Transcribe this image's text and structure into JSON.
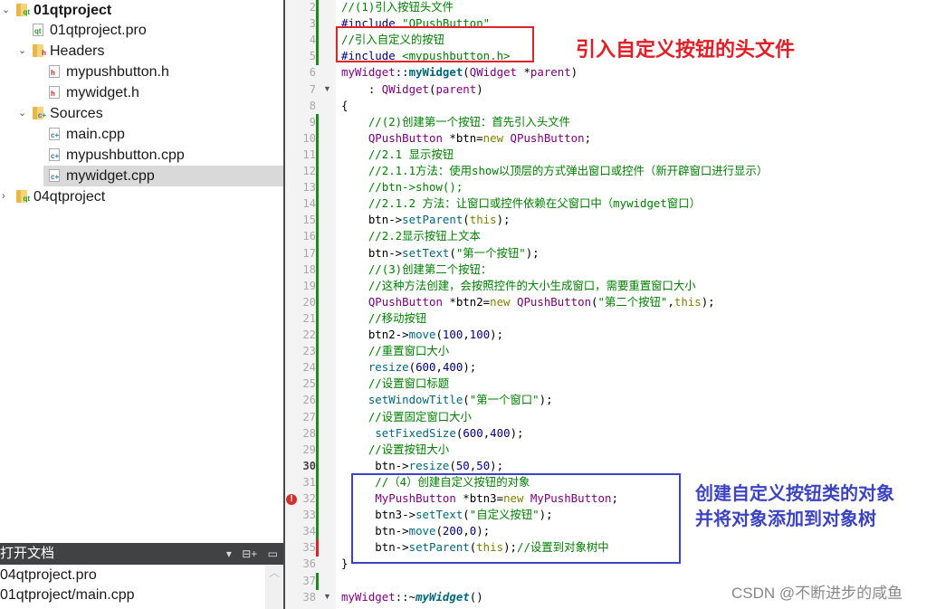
{
  "project_tree": {
    "items": [
      {
        "label": "01qtproject",
        "icon": "qt-project-folder-icon",
        "expanded": true,
        "bold": true
      },
      {
        "label": "01qtproject.pro",
        "icon": "qt-pro-file-icon"
      },
      {
        "label": "Headers",
        "icon": "headers-folder-icon",
        "expanded": true
      },
      {
        "label": "mypushbutton.h",
        "icon": "header-file-icon"
      },
      {
        "label": "mywidget.h",
        "icon": "header-file-icon"
      },
      {
        "label": "Sources",
        "icon": "sources-folder-icon",
        "expanded": true
      },
      {
        "label": "main.cpp",
        "icon": "cpp-file-icon"
      },
      {
        "label": "mypushbutton.cpp",
        "icon": "cpp-file-icon"
      },
      {
        "label": "mywidget.cpp",
        "icon": "cpp-file-icon",
        "selected": true
      },
      {
        "label": "04qtproject",
        "icon": "qt-project-folder-icon",
        "expanded": false
      }
    ]
  },
  "open_documents": {
    "title": "打开文档",
    "items": [
      "04qtproject.pro",
      "01qtproject/main.cpp"
    ]
  },
  "editor": {
    "lines": [
      {
        "n": "2",
        "parts": [
          [
            "cm",
            "//(1)引入按钮头文件"
          ]
        ]
      },
      {
        "n": "3",
        "parts": [
          [
            "pp",
            "#include "
          ],
          [
            "str",
            "\"QPushButton\""
          ]
        ]
      },
      {
        "n": "4",
        "parts": [
          [
            "cm",
            "//引入自定义的按钮"
          ]
        ]
      },
      {
        "n": "5",
        "parts": [
          [
            "pp",
            "#include "
          ],
          [
            "str",
            "<mypushbutton.h>"
          ]
        ]
      },
      {
        "n": "6",
        "parts": [
          [
            "ty",
            "myWidget"
          ],
          [
            "plain",
            "::"
          ],
          [
            "fnb",
            "myWidget"
          ],
          [
            "plain",
            "("
          ],
          [
            "ty",
            "QWidget"
          ],
          [
            "plain",
            " *"
          ],
          [
            "ty",
            "parent"
          ],
          [
            "plain",
            ")"
          ]
        ]
      },
      {
        "n": "7",
        "parts": [
          [
            "plain",
            "    : "
          ],
          [
            "ty",
            "QWidget"
          ],
          [
            "plain",
            "("
          ],
          [
            "ty",
            "parent"
          ],
          [
            "plain",
            ")"
          ]
        ]
      },
      {
        "n": "8",
        "parts": [
          [
            "plain",
            "{"
          ]
        ]
      },
      {
        "n": "9",
        "parts": [
          [
            "cm",
            "    //(2)创建第一个按钮：首先引入头文件"
          ]
        ]
      },
      {
        "n": "10",
        "parts": [
          [
            "plain",
            "    "
          ],
          [
            "ty",
            "QPushButton"
          ],
          [
            "plain",
            " *btn="
          ],
          [
            "kw",
            "new"
          ],
          [
            "plain",
            " "
          ],
          [
            "ty",
            "QPushButton"
          ],
          [
            "plain",
            ";"
          ]
        ]
      },
      {
        "n": "11",
        "parts": [
          [
            "cm",
            "    //2.1 显示按钮"
          ]
        ]
      },
      {
        "n": "12",
        "parts": [
          [
            "cm",
            "    //2.1.1方法：使用show以顶层的方式弹出窗口或控件（新开辟窗口进行显示）"
          ]
        ]
      },
      {
        "n": "13",
        "parts": [
          [
            "cm",
            "    //btn->show();"
          ]
        ]
      },
      {
        "n": "14",
        "parts": [
          [
            "cm",
            "    //2.1.2 方法：让窗口或控件依赖在父窗口中（mywidget窗口）"
          ]
        ]
      },
      {
        "n": "15",
        "parts": [
          [
            "plain",
            "    btn->"
          ],
          [
            "call",
            "setParent"
          ],
          [
            "plain",
            "("
          ],
          [
            "kw",
            "this"
          ],
          [
            "plain",
            ");"
          ]
        ]
      },
      {
        "n": "16",
        "parts": [
          [
            "cm",
            "    //2.2显示按钮上文本"
          ]
        ]
      },
      {
        "n": "17",
        "parts": [
          [
            "plain",
            "    btn->"
          ],
          [
            "call",
            "setText"
          ],
          [
            "plain",
            "("
          ],
          [
            "str",
            "\"第一个按钮\""
          ],
          [
            "plain",
            ");"
          ]
        ]
      },
      {
        "n": "18",
        "parts": [
          [
            "cm",
            "    //(3)创建第二个按钮："
          ]
        ]
      },
      {
        "n": "19",
        "parts": [
          [
            "cm",
            "    //这种方法创建，会按照控件的大小生成窗口，需要重置窗口大小"
          ]
        ]
      },
      {
        "n": "20",
        "parts": [
          [
            "plain",
            "    "
          ],
          [
            "ty",
            "QPushButton"
          ],
          [
            "plain",
            " *btn2="
          ],
          [
            "kw",
            "new"
          ],
          [
            "plain",
            " "
          ],
          [
            "ty",
            "QPushButton"
          ],
          [
            "plain",
            "("
          ],
          [
            "str",
            "\"第二个按钮\""
          ],
          [
            "plain",
            ","
          ],
          [
            "kw",
            "this"
          ],
          [
            "plain",
            ");"
          ]
        ]
      },
      {
        "n": "21",
        "parts": [
          [
            "cm",
            "    //移动按钮"
          ]
        ]
      },
      {
        "n": "22",
        "parts": [
          [
            "plain",
            "    btn2->"
          ],
          [
            "call",
            "move"
          ],
          [
            "plain",
            "("
          ],
          [
            "num",
            "100"
          ],
          [
            "plain",
            ","
          ],
          [
            "num",
            "100"
          ],
          [
            "plain",
            ");"
          ]
        ]
      },
      {
        "n": "23",
        "parts": [
          [
            "cm",
            "    //重置窗口大小"
          ]
        ]
      },
      {
        "n": "24",
        "parts": [
          [
            "plain",
            "    "
          ],
          [
            "call",
            "resize"
          ],
          [
            "plain",
            "("
          ],
          [
            "num",
            "600"
          ],
          [
            "plain",
            ","
          ],
          [
            "num",
            "400"
          ],
          [
            "plain",
            ");"
          ]
        ]
      },
      {
        "n": "25",
        "parts": [
          [
            "cm",
            "    //设置窗口标题"
          ]
        ]
      },
      {
        "n": "26",
        "parts": [
          [
            "plain",
            "    "
          ],
          [
            "call",
            "setWindowTitle"
          ],
          [
            "plain",
            "("
          ],
          [
            "str",
            "\"第一个窗口\""
          ],
          [
            "plain",
            ");"
          ]
        ]
      },
      {
        "n": "27",
        "parts": [
          [
            "cm",
            "    //设置固定窗口大小"
          ]
        ]
      },
      {
        "n": "28",
        "parts": [
          [
            "plain",
            "     "
          ],
          [
            "call",
            "setFixedSize"
          ],
          [
            "plain",
            "("
          ],
          [
            "num",
            "600"
          ],
          [
            "plain",
            ","
          ],
          [
            "num",
            "400"
          ],
          [
            "plain",
            ");"
          ]
        ]
      },
      {
        "n": "29",
        "parts": [
          [
            "cm",
            "    //设置按钮大小"
          ]
        ]
      },
      {
        "n": "30",
        "parts": [
          [
            "plain",
            "     btn->"
          ],
          [
            "call",
            "resize"
          ],
          [
            "plain",
            "("
          ],
          [
            "num",
            "50"
          ],
          [
            "plain",
            ","
          ],
          [
            "num",
            "50"
          ],
          [
            "plain",
            ");"
          ]
        ]
      },
      {
        "n": "31",
        "parts": [
          [
            "cm",
            "     //（4）创建自定义按钮的对象"
          ]
        ]
      },
      {
        "n": "32",
        "parts": [
          [
            "plain",
            "     "
          ],
          [
            "ty",
            "MyPushButton"
          ],
          [
            "plain",
            " *btn3="
          ],
          [
            "kw",
            "new"
          ],
          [
            "plain",
            " "
          ],
          [
            "ty",
            "MyPushButton"
          ],
          [
            "plain",
            ";"
          ]
        ]
      },
      {
        "n": "33",
        "parts": [
          [
            "plain",
            "     btn3->"
          ],
          [
            "call",
            "setText"
          ],
          [
            "plain",
            "("
          ],
          [
            "str",
            "\"自定义按钮\""
          ],
          [
            "plain",
            ");"
          ]
        ]
      },
      {
        "n": "34",
        "parts": [
          [
            "plain",
            "     btn->"
          ],
          [
            "call",
            "move"
          ],
          [
            "plain",
            "("
          ],
          [
            "num",
            "200"
          ],
          [
            "plain",
            ","
          ],
          [
            "num",
            "0"
          ],
          [
            "plain",
            ");"
          ]
        ]
      },
      {
        "n": "35",
        "parts": [
          [
            "plain",
            "     btn->"
          ],
          [
            "call",
            "setParent"
          ],
          [
            "plain",
            "("
          ],
          [
            "kw",
            "this"
          ],
          [
            "plain",
            ");"
          ],
          [
            "cm",
            "//设置到对象树中"
          ]
        ]
      },
      {
        "n": "36",
        "parts": [
          [
            "plain",
            "}"
          ]
        ]
      },
      {
        "n": "37",
        "parts": []
      },
      {
        "n": "38",
        "parts": [
          [
            "ty",
            "myWidget"
          ],
          [
            "plain",
            "::~"
          ],
          [
            "fni",
            "myWidget"
          ],
          [
            "plain",
            "()"
          ]
        ]
      }
    ],
    "current_line": "30",
    "error_line": "32"
  },
  "annotations": {
    "red": "引入自定义按钮的头文件",
    "blue_line1": "创建自定义按钮类的对象",
    "blue_line2": "并将对象添加到对象树"
  },
  "watermark": "CSDN @不断进步的咸鱼",
  "colors": {
    "red_box": "#e0232a",
    "blue_box": "#3c44c4",
    "change_bar_green": "#1a8a1a",
    "change_bar_red": "#e02020"
  }
}
